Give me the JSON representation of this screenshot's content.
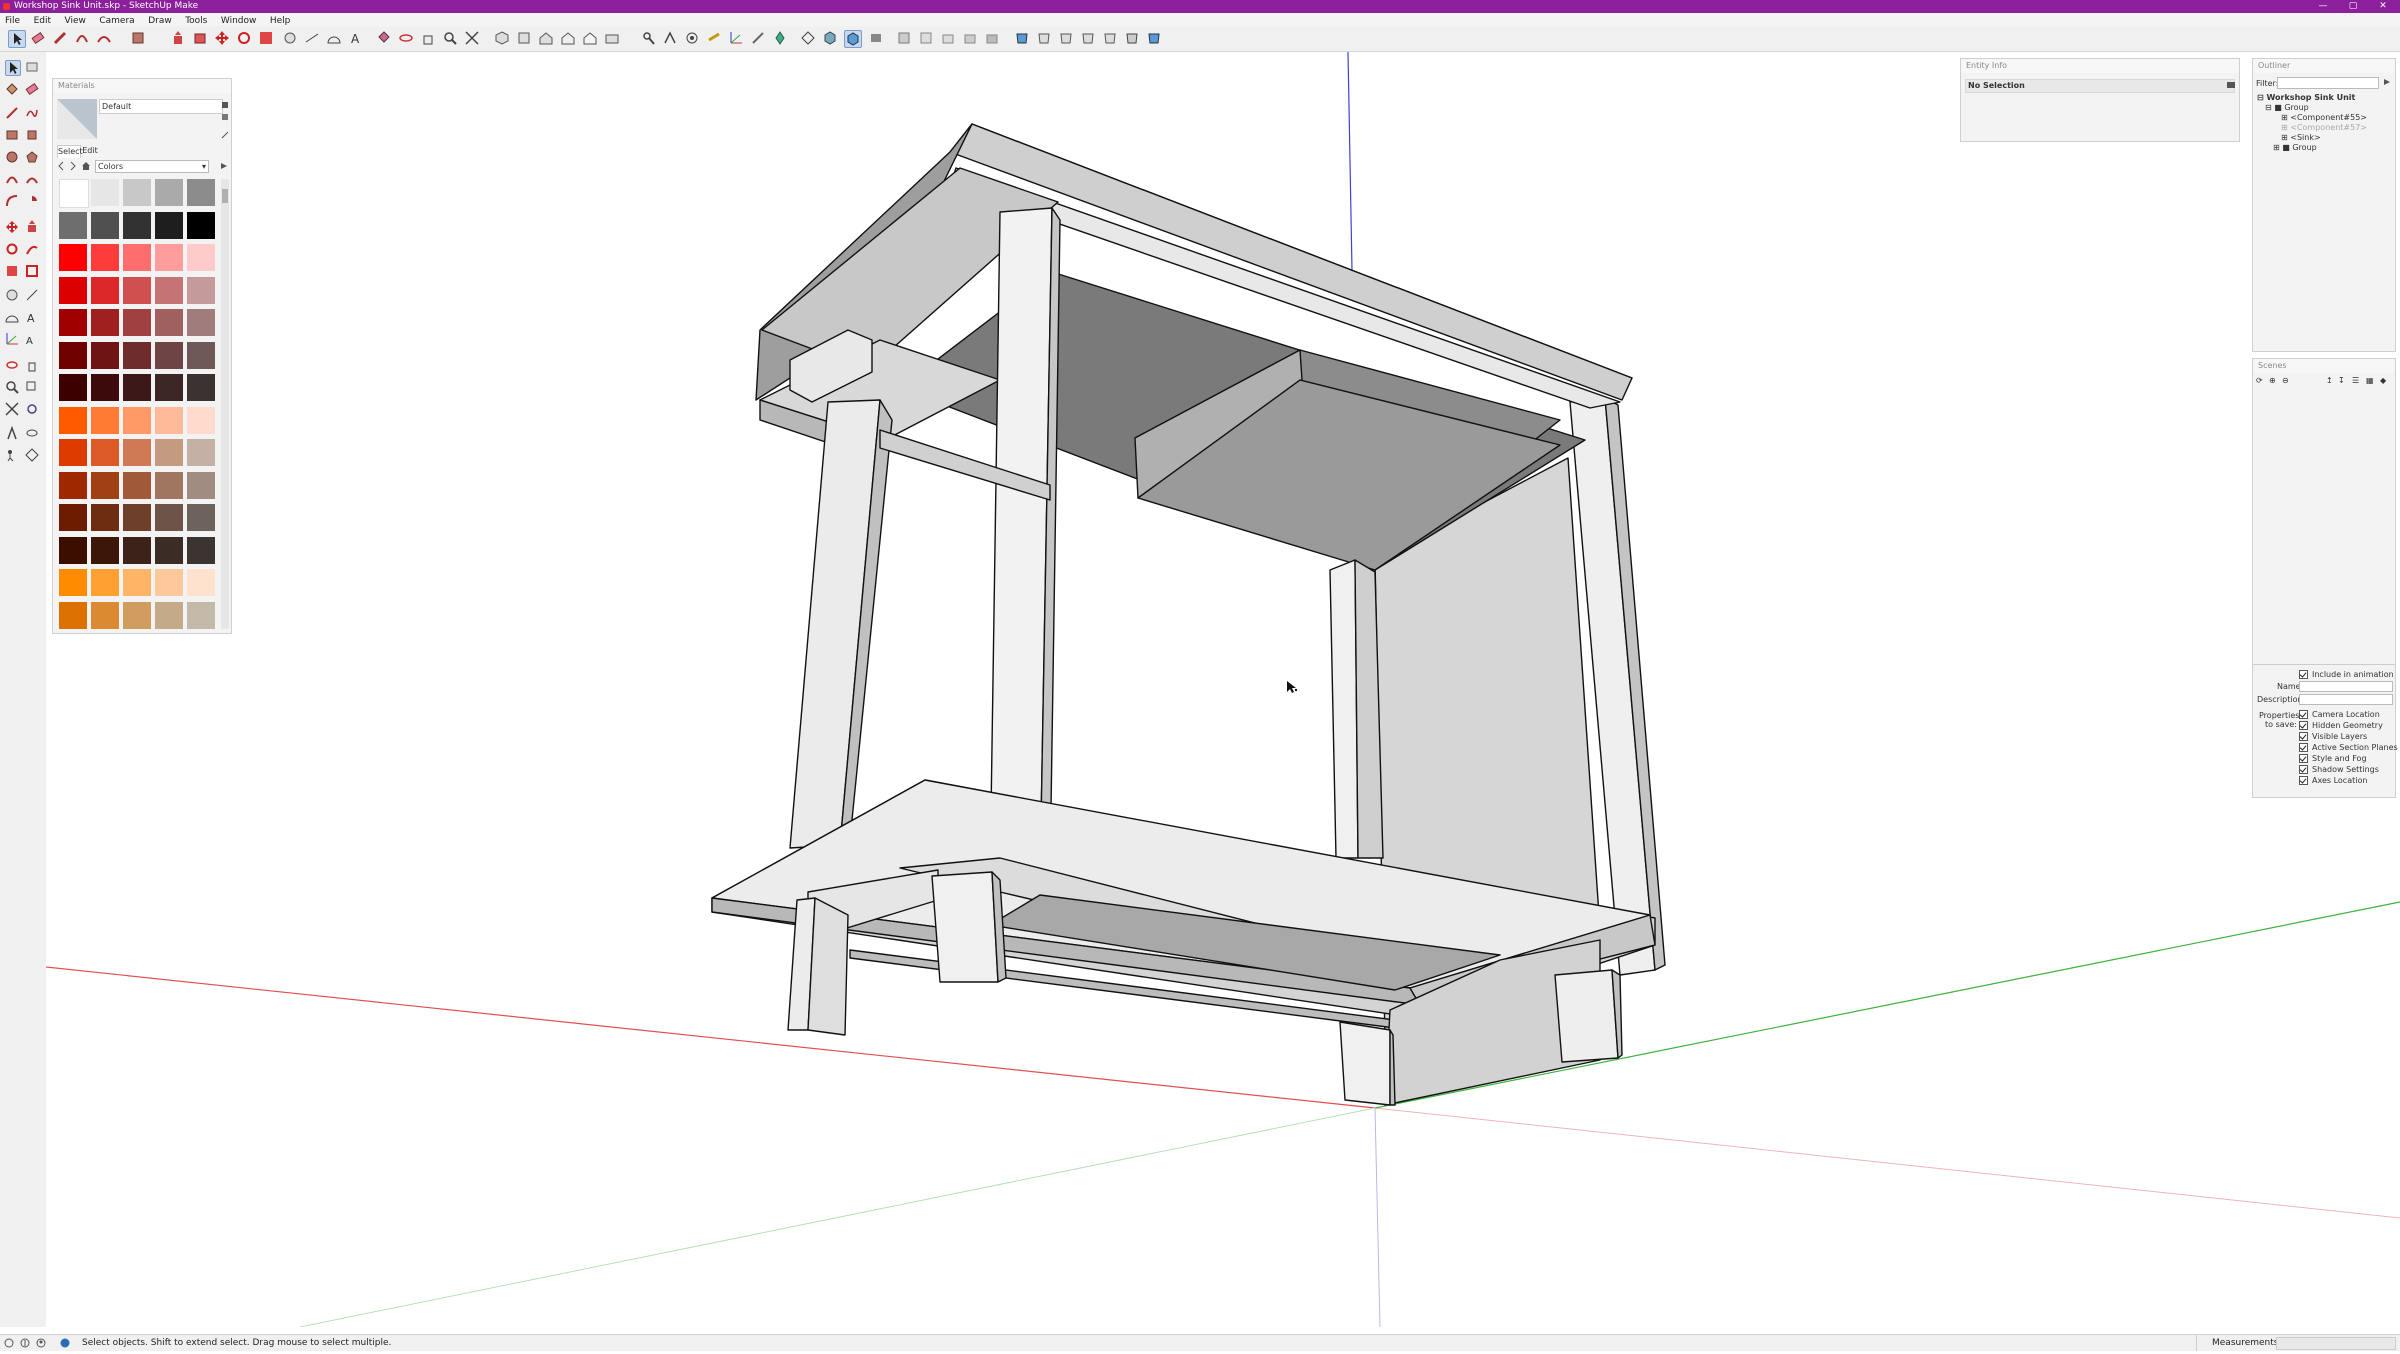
{
  "window": {
    "title": "Workshop Sink Unit.skp - SketchUp Make",
    "controls": [
      "—",
      "▢",
      "✕"
    ]
  },
  "menu": [
    "File",
    "Edit",
    "View",
    "Camera",
    "Draw",
    "Tools",
    "Window",
    "Help"
  ],
  "materials": {
    "header": "Materials",
    "current_material": "Default",
    "tabs": [
      "Select",
      "Edit"
    ],
    "library": "Colors",
    "swatches": [
      [
        "#ffffff",
        "#e6e6e6",
        "#c8c8c8",
        "#aaaaaa",
        "#8c8c8c"
      ],
      [
        "#6e6e6e",
        "#505050",
        "#323232",
        "#1e1e1e",
        "#000000"
      ],
      [
        "#ff0000",
        "#ff3c3c",
        "#ff6e6e",
        "#ff9c9c",
        "#ffcaca"
      ],
      [
        "#dc0000",
        "#dc2828",
        "#d05050",
        "#c47474",
        "#c49a9a"
      ],
      [
        "#a00000",
        "#a02020",
        "#a04040",
        "#a06060",
        "#a07c7c"
      ],
      [
        "#6e0000",
        "#6e1414",
        "#6e2c2c",
        "#6e4444",
        "#6e5858"
      ],
      [
        "#3c0000",
        "#3c0a0a",
        "#3c1818",
        "#3c2626",
        "#3c3232"
      ],
      [
        "#ff5a00",
        "#ff7a32",
        "#ff9a66",
        "#ffba9a",
        "#ffdacd"
      ],
      [
        "#dc3c00",
        "#dc5a28",
        "#d07a55",
        "#c49a80",
        "#c4b0a5"
      ],
      [
        "#a02800",
        "#a04014",
        "#a05a3a",
        "#a07660",
        "#a08c80"
      ],
      [
        "#6e1c00",
        "#6e2c10",
        "#6e402c",
        "#6e5448",
        "#6e625c"
      ],
      [
        "#3c0e00",
        "#3c1608",
        "#3c2218",
        "#3c2c26",
        "#3c3430"
      ],
      [
        "#ff8c00",
        "#ffa032",
        "#ffb466",
        "#ffc89a",
        "#ffe2cd"
      ],
      [
        "#dc7000",
        "#dc8a32",
        "#d09c60",
        "#c4aa88",
        "#c4b8a8"
      ]
    ]
  },
  "entity_info": {
    "header": "Entity Info",
    "selection": "No Selection"
  },
  "outliner": {
    "header": "Outliner",
    "filter_label": "Filter:",
    "filter_value": "",
    "root": "Workshop Sink Unit",
    "items": [
      {
        "label": "Group",
        "level": 1
      },
      {
        "label": "<Component#55>",
        "level": 2
      },
      {
        "label": "<Component#57>",
        "level": 2
      },
      {
        "label": "<Sink>",
        "level": 2
      },
      {
        "label": "Group",
        "level": 2
      }
    ]
  },
  "scenes": {
    "header": "Scenes",
    "include_label": "Include in animation",
    "name_label": "Name:",
    "name_value": "",
    "description_label": "Description:",
    "description_value": "",
    "properties_label": "Properties to save:",
    "properties": [
      "Camera Location",
      "Hidden Geometry",
      "Visible Layers",
      "Active Section Planes",
      "Style and Fog",
      "Shadow Settings",
      "Axes Location"
    ]
  },
  "status": {
    "hint": "Select objects. Shift to extend select. Drag mouse to select multiple.",
    "measurements_label": "Measurements",
    "measurements_value": ""
  },
  "colors": {
    "titlebar": "#8b1f9c",
    "axis_red": "#e05050",
    "axis_green": "#3cb43c",
    "axis_blue": "#4040d0",
    "model_light": "#e6e6e6",
    "model_mid": "#b4b4b4",
    "model_dark": "#7a7a7a"
  },
  "icons": [
    "select-arrow-icon",
    "eraser-icon",
    "paint-bucket-icon",
    "pencil-icon",
    "rectangle-icon",
    "circle-icon",
    "arc-icon",
    "push-pull-icon",
    "move-icon",
    "rotate-icon",
    "scale-icon",
    "offset-icon",
    "tape-measure-icon",
    "text-icon",
    "axes-icon",
    "orbit-icon",
    "pan-icon",
    "zoom-icon",
    "zoom-extents-icon",
    "walk-icon",
    "position-camera-icon"
  ]
}
